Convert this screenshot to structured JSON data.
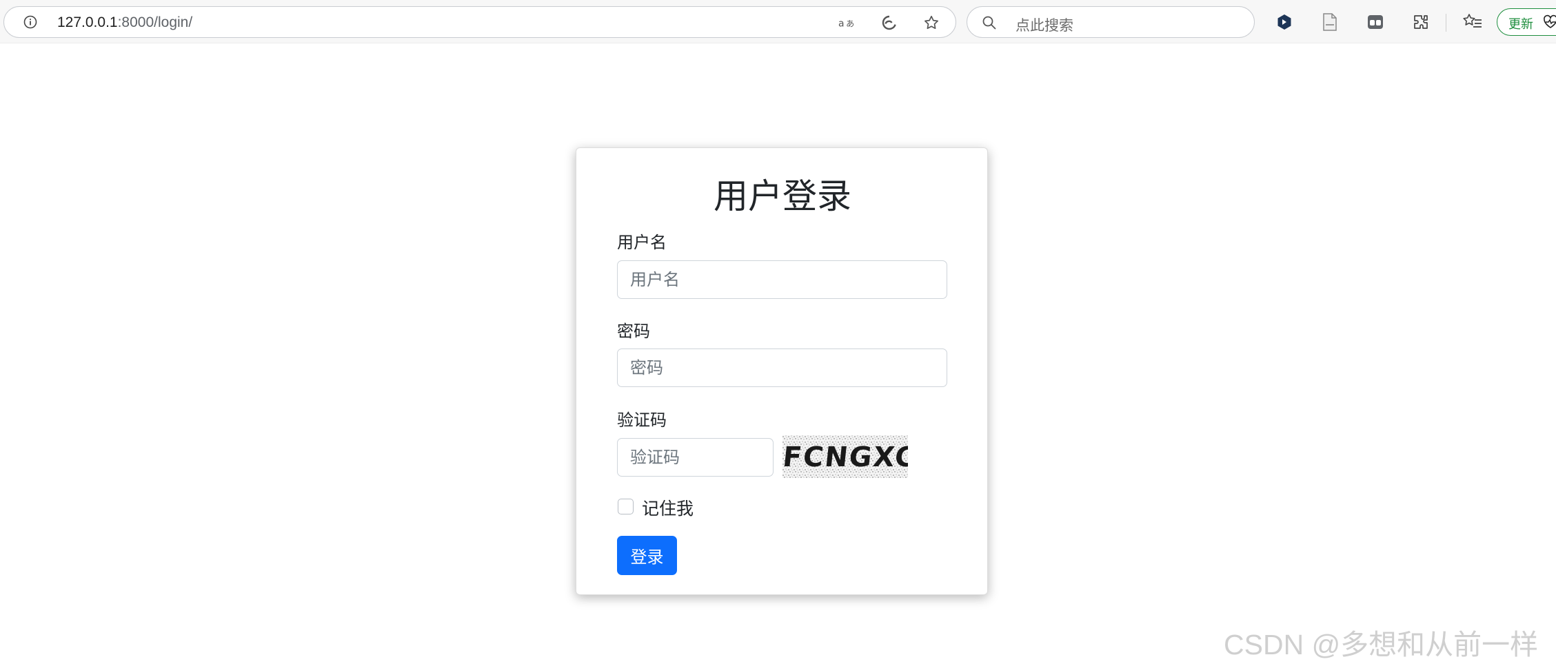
{
  "browser": {
    "url_host": "127.0.0.1",
    "url_path": ":8000/login/",
    "search_placeholder": "点此搜索",
    "update_label": "更新",
    "icons": [
      "info-icon",
      "read-aloud-icon",
      "edge-refresh-icon",
      "favorite-star-icon",
      "search-icon",
      "extension-hex-icon",
      "document-icon",
      "workspace-icon",
      "puzzle-icon",
      "favorites-list-icon",
      "heart-pulse-icon"
    ]
  },
  "login": {
    "title": "用户登录",
    "username_label": "用户名",
    "username_placeholder": "用户名",
    "password_label": "密码",
    "password_placeholder": "密码",
    "captcha_label": "验证码",
    "captcha_placeholder": "验证码",
    "captcha_text": "FCNGXC",
    "remember_label": "记住我",
    "remember_checked": false,
    "submit_label": "登录",
    "accent_color": "#0d6efd"
  },
  "watermark": "CSDN @多想和从前一样"
}
